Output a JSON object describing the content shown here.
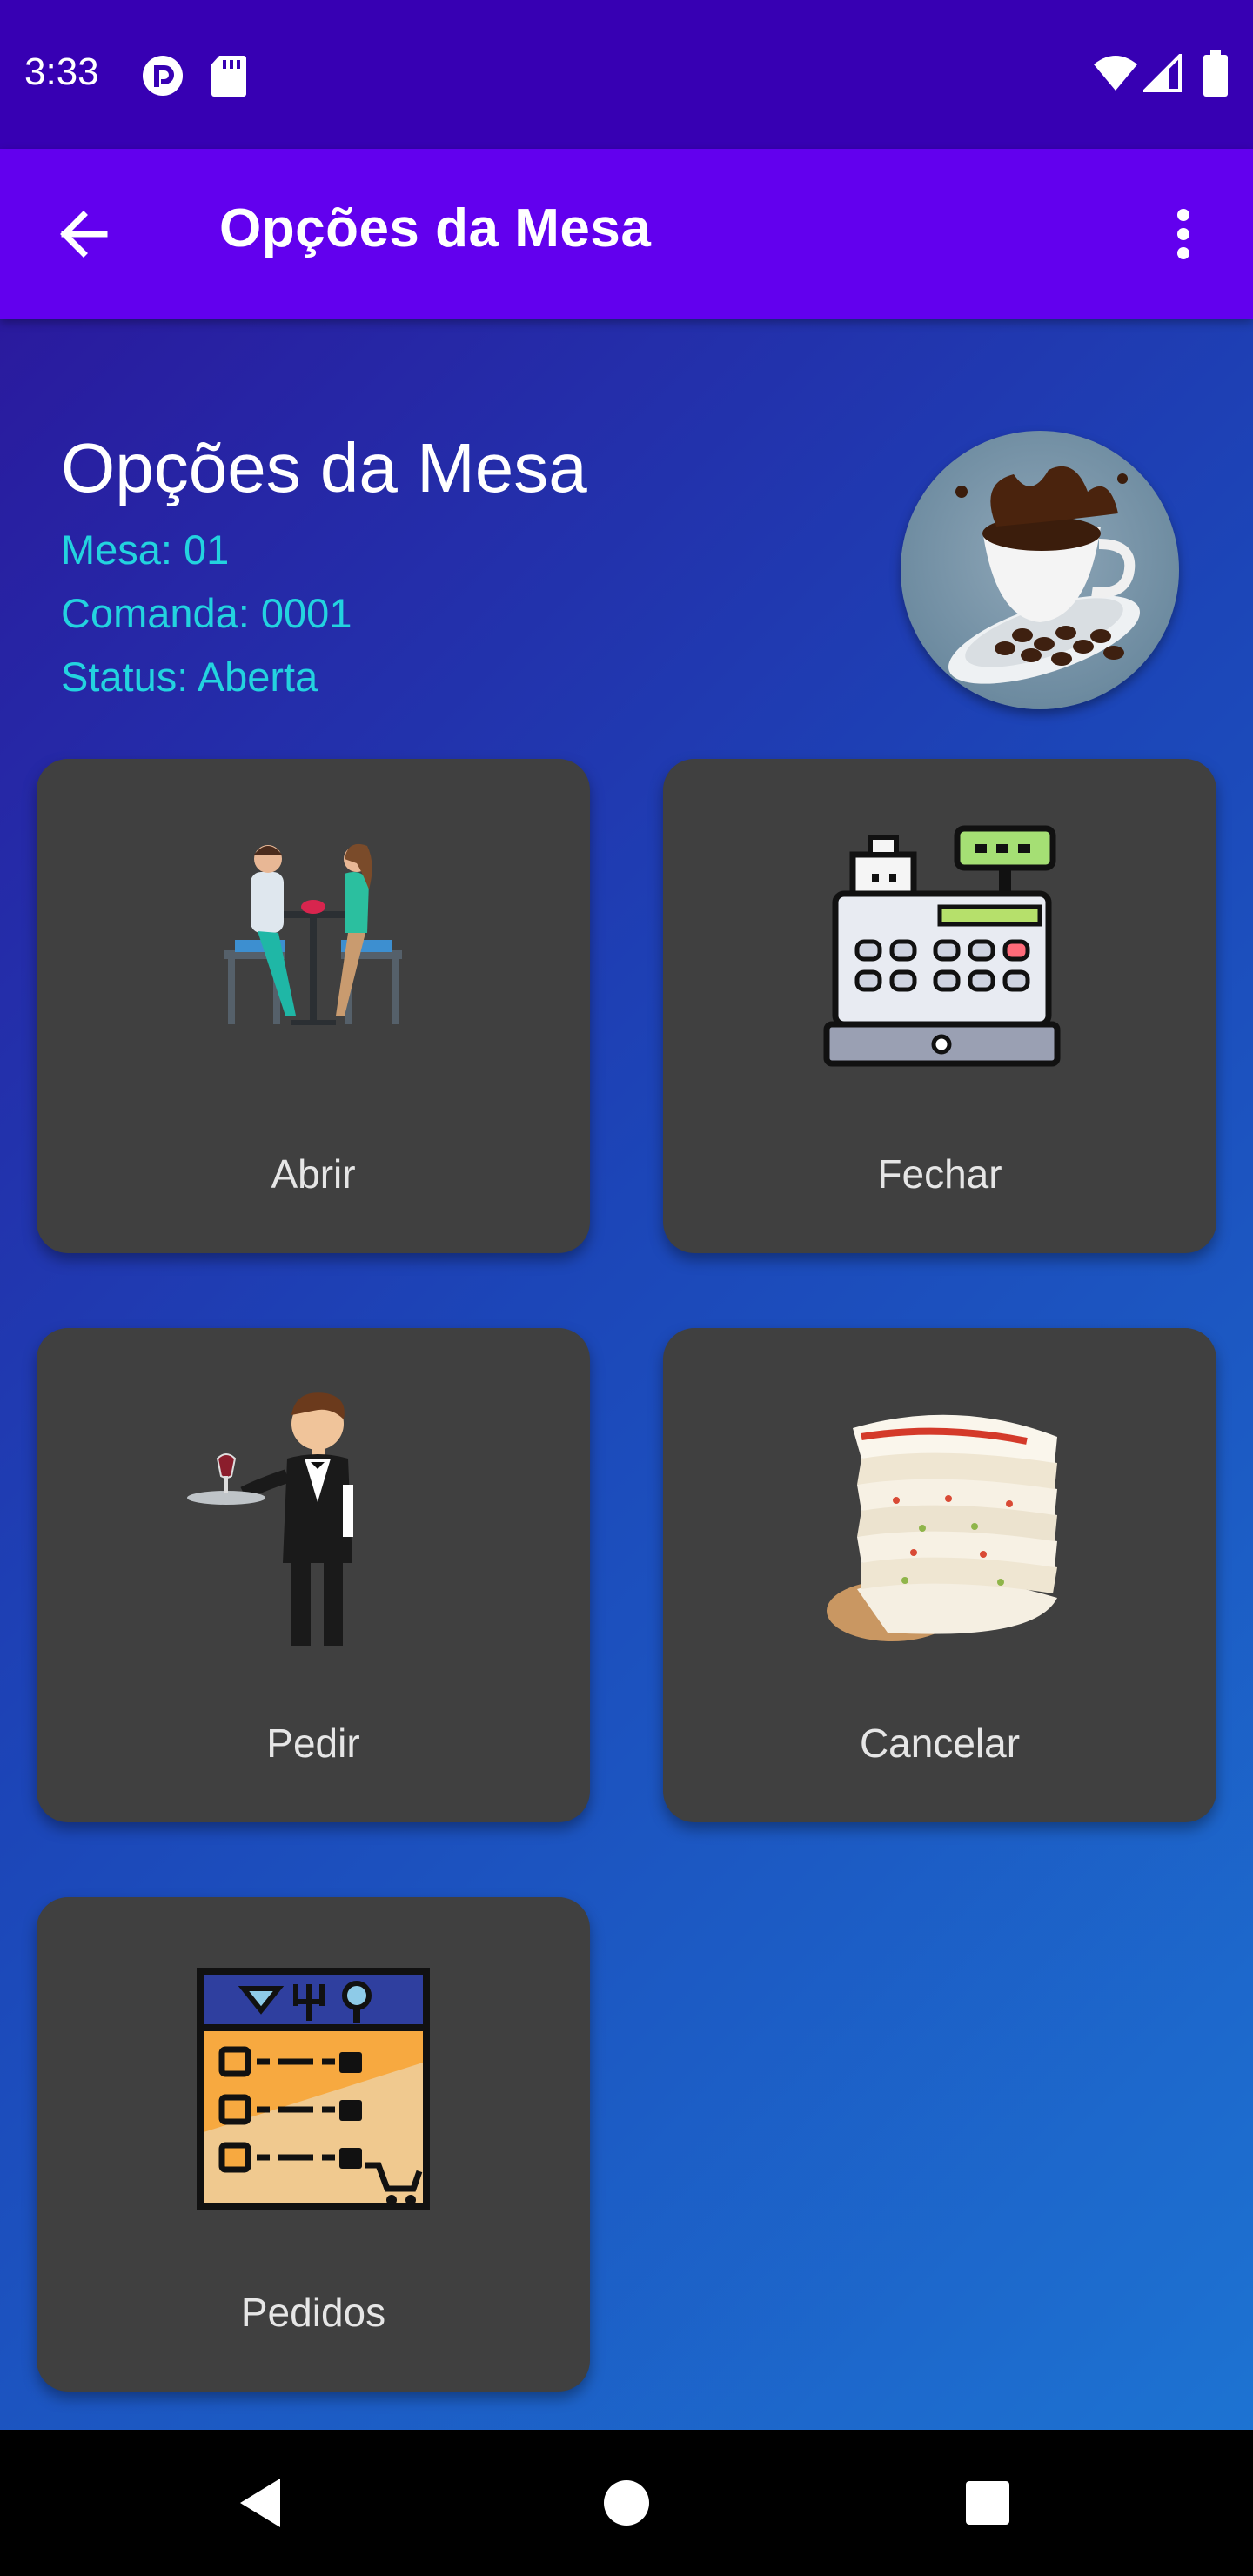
{
  "status_bar": {
    "time": "3:33",
    "icons": [
      "pocket-casts-icon",
      "sd-card-icon",
      "wifi-icon",
      "signal-icon",
      "battery-icon"
    ]
  },
  "app_bar": {
    "title": "Opções da Mesa",
    "back_icon": "arrow-back-icon",
    "menu_icon": "more-vert-icon"
  },
  "header": {
    "title": "Opções da Mesa",
    "mesa": "Mesa: 01",
    "comanda": "Comanda: 0001",
    "status": "Status: Aberta",
    "avatar_icon": "coffee-cup-icon"
  },
  "cards": [
    {
      "label": "Abrir",
      "icon": "couple-dining-icon"
    },
    {
      "label": "Fechar",
      "icon": "cash-register-icon"
    },
    {
      "label": "Pedir",
      "icon": "waiter-icon"
    },
    {
      "label": "Cancelar",
      "icon": "tapioca-stack-icon"
    },
    {
      "label": "Pedidos",
      "icon": "order-list-icon"
    }
  ],
  "nav_bar": {
    "icons": [
      "back-triangle-icon",
      "home-circle-icon",
      "recents-square-icon"
    ]
  },
  "colors": {
    "status_bar": "#3700b3",
    "app_bar": "#6200ee",
    "info_text": "#23d3df",
    "card_bg": "#404040"
  }
}
